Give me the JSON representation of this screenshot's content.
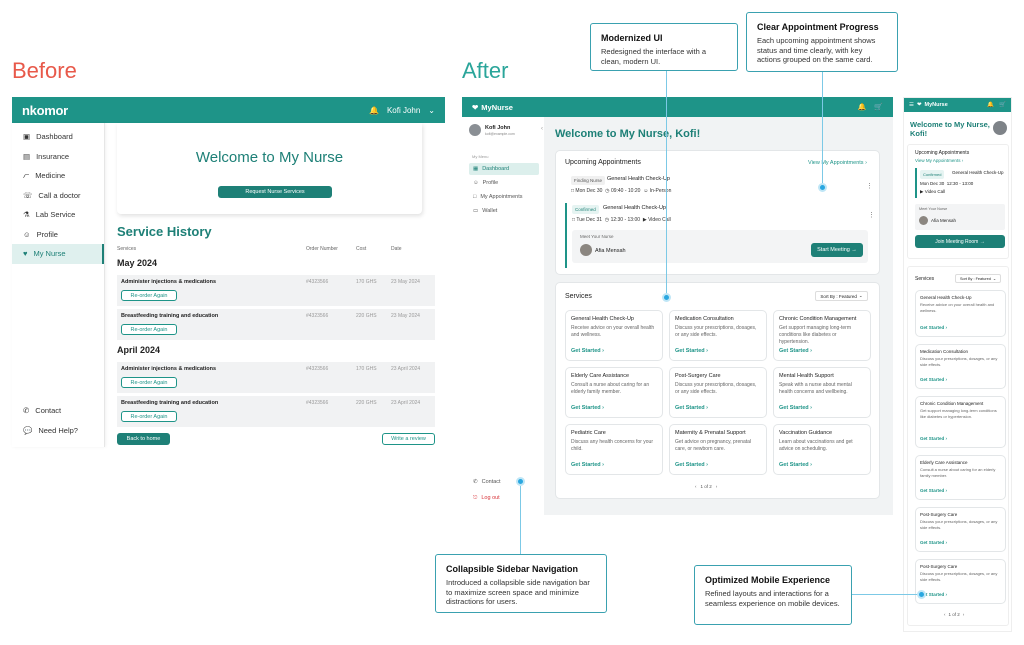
{
  "labels": {
    "before": "Before",
    "after": "After"
  },
  "colors": {
    "teal": "#1e9488",
    "before_label": "#e8594a",
    "after_label": "#2aa59a"
  },
  "before": {
    "logo": "nkomor",
    "user": "Kofi John",
    "nav": [
      "Dashboard",
      "Insurance",
      "Medicine",
      "Call a doctor",
      "Lab Service",
      "Profile",
      "My Nurse"
    ],
    "nav_bottom": [
      "Contact",
      "Need Help?"
    ],
    "welcome": "Welcome to My Nurse",
    "request_btn": "Request Nurse Services",
    "history_title": "Service History",
    "cols": [
      "Services",
      "Order Number",
      "Cost",
      "Date"
    ],
    "groups": [
      {
        "month": "May 2024",
        "rows": [
          {
            "service": "Administer injections & medications",
            "order": "#4323566",
            "cost": "170 GHS",
            "date": "23 May 2024",
            "btn": "Re-order Again"
          },
          {
            "service": "Breastfeeding training and education",
            "order": "#4323566",
            "cost": "220 GHS",
            "date": "23 May 2024",
            "btn": "Re-order Again"
          }
        ]
      },
      {
        "month": "April 2024",
        "rows": [
          {
            "service": "Administer injections & medications",
            "order": "#4323566",
            "cost": "170 GHS",
            "date": "23 April 2024",
            "btn": "Re-order Again"
          },
          {
            "service": "Breastfeeding training and education",
            "order": "#4323566",
            "cost": "220 GHS",
            "date": "23 April 2024",
            "btn": "Re-order Again"
          }
        ]
      }
    ],
    "back_btn": "Back to home",
    "review_btn": "Write a review"
  },
  "after": {
    "logo": "MyNurse",
    "user_name": "Kofi John",
    "user_email": "kofi@example.com",
    "menu_label": "My Menu",
    "nav": [
      "Dashboard",
      "Profile",
      "My Appointments",
      "Wallet"
    ],
    "contact": "Contact",
    "logout": "Log out",
    "welcome": "Welcome to My Nurse, Kofi!",
    "upcoming_title": "Upcoming Appointments",
    "view_appointments": "View My Appointments",
    "appts": [
      {
        "status": "Finding Nurse",
        "title": "General Health Check-Up",
        "date": "Mon Dec 30",
        "time": "09:40 - 10:20",
        "mode": "In-Person"
      },
      {
        "status": "Confirmed",
        "title": "General Health Check-Up",
        "date": "Tue Dec 31",
        "time": "12:30 - 13:00",
        "mode": "Video Call"
      }
    ],
    "meet_label": "Meet Your Nurse",
    "nurse": "Afia Mensah",
    "start_btn": "Start Meeting",
    "services_title": "Services",
    "sort": "Sort By : Featured",
    "services": [
      {
        "title": "General Health Check-Up",
        "desc": "Receive advice on your overall health and wellness."
      },
      {
        "title": "Medication Consultation",
        "desc": "Discuss your prescriptions, dosages, or any side effects."
      },
      {
        "title": "Chronic Condition Management",
        "desc": "Get support managing long-term conditions like diabetes or hypertension."
      },
      {
        "title": "Elderly Care Assistance",
        "desc": "Consult a nurse about caring for an elderly family member."
      },
      {
        "title": "Post-Surgery Care",
        "desc": "Discuss your prescriptions, dosages, or any side effects."
      },
      {
        "title": "Mental Health Support",
        "desc": "Speak with a nurse about mental health concerns and wellbeing."
      },
      {
        "title": "Pediatric Care",
        "desc": "Discuss any health concerns for your child."
      },
      {
        "title": "Maternity & Prenatal Support",
        "desc": "Get advice on pregnancy, prenatal care, or newborn care."
      },
      {
        "title": "Vaccination Guidance",
        "desc": "Learn about vaccinations and get advice on scheduling."
      }
    ],
    "get_started": "Get Started",
    "pager": "1 of 2"
  },
  "mobile": {
    "logo": "MyNurse",
    "welcome": "Welcome to My Nurse, Kofi!",
    "upcoming": "Upcoming Appointments",
    "view": "View My Appointments",
    "appt": {
      "status": "Confirmed",
      "title": "General Health Check-Up",
      "date": "Mon Dec 30",
      "time": "12:30 - 13:00",
      "mode": "Video Call"
    },
    "meet": "Meet Your Nurse",
    "nurse": "Afia Mensah",
    "join_btn": "Join Meeting Room",
    "services_title": "Services",
    "sort": "Sort By : Featured",
    "services": [
      {
        "title": "General Health Check-Up",
        "desc": "Receive advice on your overall health and wellness."
      },
      {
        "title": "Medication Consultation",
        "desc": "Discuss your prescriptions, dosages, or any side effects."
      },
      {
        "title": "Chronic Condition Management",
        "desc": "Get support managing long-term conditions like diabetes or hypertension."
      },
      {
        "title": "Elderly Care Assistance",
        "desc": "Consult a nurse about caring for an elderly family member."
      },
      {
        "title": "Post-Surgery Care",
        "desc": "Discuss your prescriptions, dosages, or any side effects."
      },
      {
        "title": "Post-Surgery Care",
        "desc": "Discuss your prescriptions, dosages, or any side effects."
      }
    ],
    "get_started": "Get Started",
    "pager": "1 of 2"
  },
  "callouts": [
    {
      "title": "Modernized UI",
      "body": "Redesigned the interface with a clean, modern UI."
    },
    {
      "title": "Clear Appointment Progress",
      "body": "Each upcoming appointment shows status and time clearly, with key actions grouped on the same card."
    },
    {
      "title": "Collapsible Sidebar Navigation",
      "body": "Introduced a collapsible side navigation bar to maximize screen space and minimize distractions for users."
    },
    {
      "title": "Optimized Mobile Experience",
      "body": "Refined layouts and interactions for a seamless experience on mobile devices."
    }
  ]
}
